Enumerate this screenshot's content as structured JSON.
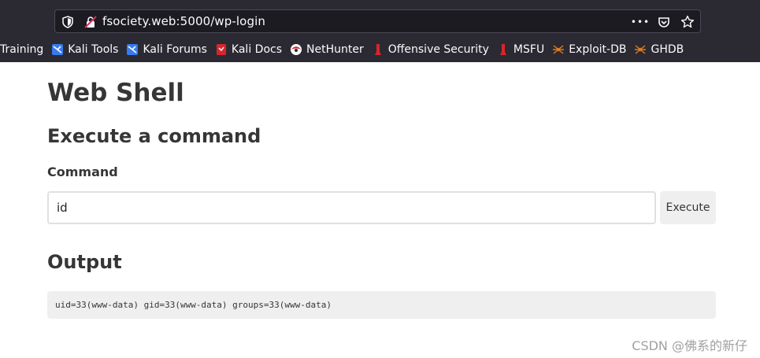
{
  "browser": {
    "url": "fsociety.web:5000/wp-login",
    "url_icons": [
      "shield-icon",
      "insecure-lock-icon"
    ],
    "action_icons": [
      "more-dots-icon",
      "pocket-icon",
      "star-icon"
    ],
    "bookmarks": [
      {
        "label": "Training",
        "icon": "none"
      },
      {
        "label": "Kali Tools",
        "icon": "kali-icon"
      },
      {
        "label": "Kali Forums",
        "icon": "kali-icon"
      },
      {
        "label": "Kali Docs",
        "icon": "kali-docs-icon"
      },
      {
        "label": "NetHunter",
        "icon": "nethunter-icon"
      },
      {
        "label": "Offensive Security",
        "icon": "offsec-icon"
      },
      {
        "label": "MSFU",
        "icon": "offsec-icon"
      },
      {
        "label": "Exploit-DB",
        "icon": "spider-icon"
      },
      {
        "label": "GHDB",
        "icon": "spider-icon"
      }
    ],
    "more_actions_glyph": "•••"
  },
  "page": {
    "title": "Web Shell",
    "section_title": "Execute a command",
    "command_label": "Command",
    "command_value": "id",
    "execute_label": "Execute",
    "output_title": "Output",
    "output_text": "uid=33(www-data) gid=33(www-data) groups=33(www-data)"
  },
  "watermark": "CSDN @佛系的新仔",
  "colors": {
    "chrome_bg": "#2b2a33",
    "urlbar_bg": "#1c1b22",
    "text_dark": "#363636",
    "button_bg": "#efefef",
    "offsec_red": "#d6262b",
    "exploitdb_orange": "#e07b1f"
  }
}
